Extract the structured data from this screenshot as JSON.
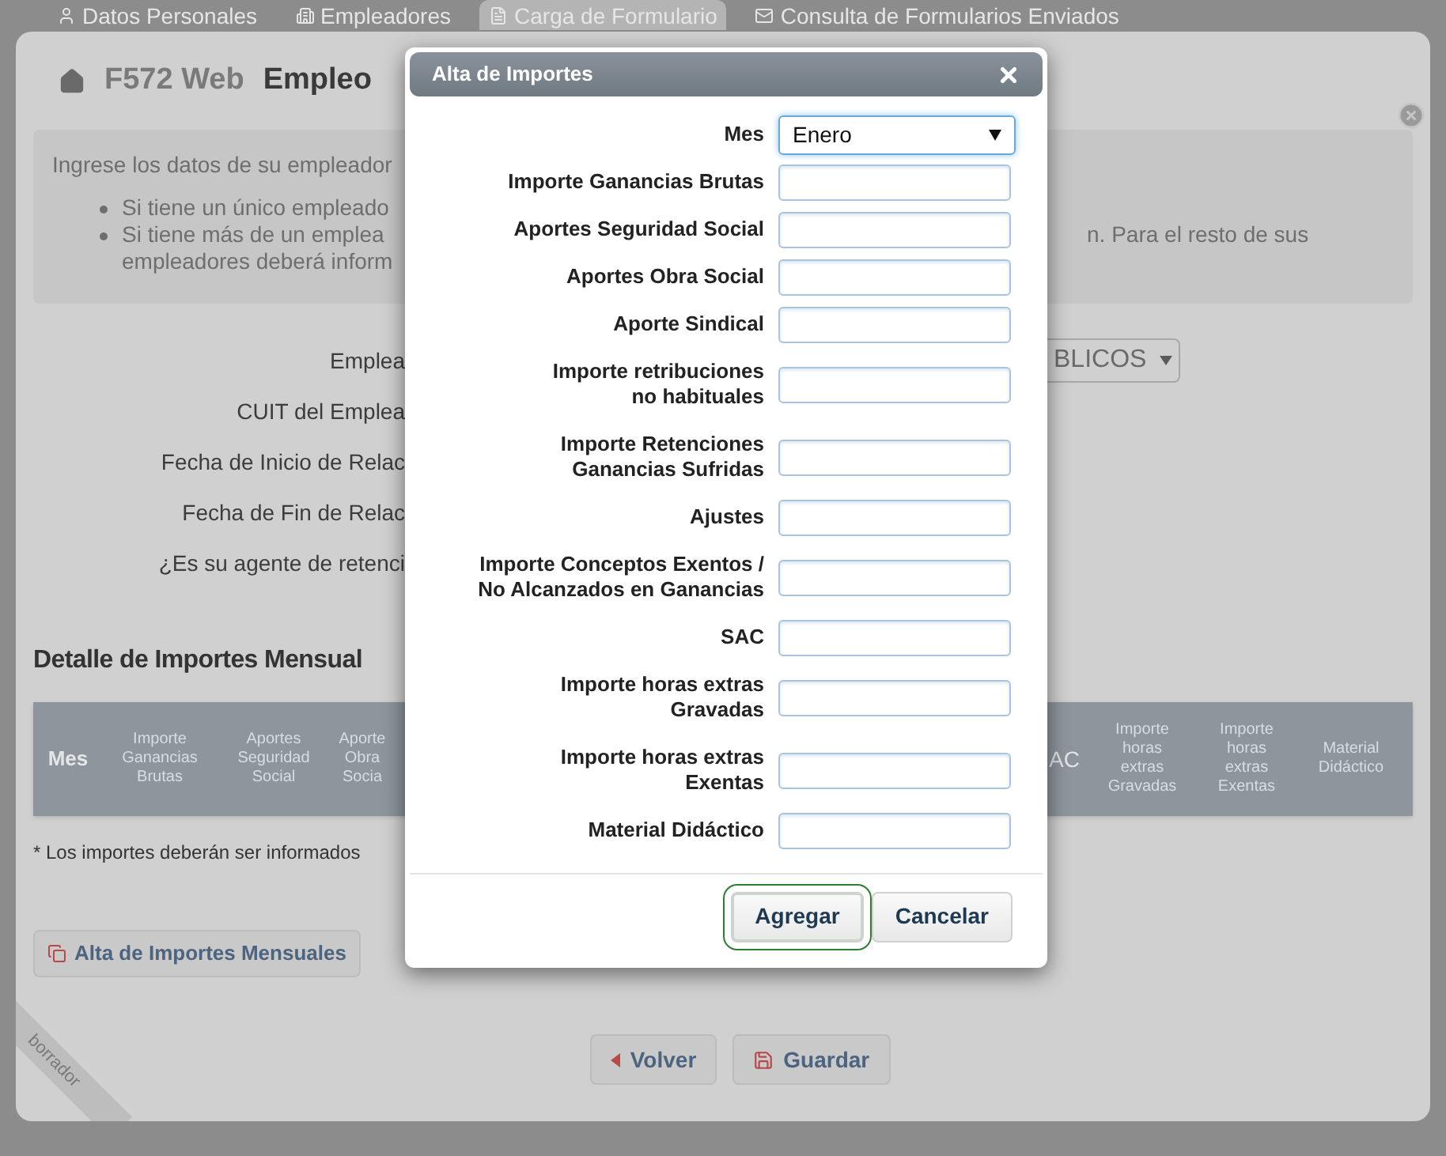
{
  "tabs": [
    {
      "label": "Datos Personales",
      "selected": false
    },
    {
      "label": "Empleadores",
      "selected": false
    },
    {
      "label": "Carga de Formulario",
      "selected": true
    },
    {
      "label": "Consulta de Formularios Enviados",
      "selected": false
    }
  ],
  "breadcrumb": [
    "F572 Web",
    "Empleo"
  ],
  "info": {
    "intro": "Ingrese los datos de su empleador",
    "bullets": [
      {
        "lines": [
          {
            "left": "Si tiene un único empleado"
          }
        ]
      },
      {
        "lines": [
          {
            "left": "Si tiene más de un emplea",
            "right": "n. Para el resto de sus"
          },
          {
            "left": "empleadores deberá inform"
          }
        ]
      }
    ]
  },
  "employer_form": [
    {
      "label": "Emplea",
      "value": "BLICOS"
    },
    {
      "label": "CUIT del Emplea"
    },
    {
      "label": "Fecha de Inicio de Relac"
    },
    {
      "label": "Fecha de Fin de Relac"
    },
    {
      "label": "¿Es su agente de retenci"
    }
  ],
  "detail_title": "Detalle de Importes Mensual",
  "table": {
    "columns_left": [
      "Mes",
      "Importe Ganancias Brutas",
      "Aportes Seguridad Social",
      "Aporte Obra Socia"
    ],
    "columns_right": [
      "AC",
      "Importe horas extras Gravadas",
      "Importe horas extras Exentas",
      "Material Didáctico"
    ]
  },
  "footnote": "* Los importes deberán ser informados",
  "add_button": "Alta de Importes Mensuales",
  "ribbon": "borrador",
  "bottom_buttons": [
    {
      "label": "Volver"
    },
    {
      "label": "Guardar"
    }
  ],
  "dialog": {
    "title": "Alta de Importes",
    "fields": [
      {
        "kind": "select",
        "label": "Mes",
        "value": "Enero"
      },
      {
        "kind": "input",
        "label": "Importe Ganancias Brutas"
      },
      {
        "kind": "input",
        "label": "Aportes Seguridad Social"
      },
      {
        "kind": "input",
        "label": "Aportes Obra Social"
      },
      {
        "kind": "input",
        "label": "Aporte Sindical"
      },
      {
        "kind": "input",
        "label": "Importe retribuciones\nno habituales"
      },
      {
        "kind": "input",
        "label": "Importe Retenciones\nGanancias Sufridas"
      },
      {
        "kind": "input",
        "label": "Ajustes"
      },
      {
        "kind": "input",
        "label": "Importe Conceptos Exentos /\nNo Alcanzados en Ganancias"
      },
      {
        "kind": "input",
        "label": "SAC"
      },
      {
        "kind": "input",
        "label": "Importe horas extras\nGravadas"
      },
      {
        "kind": "input",
        "label": "Importe horas extras\nExentas"
      },
      {
        "kind": "input",
        "label": "Material Didáctico"
      }
    ],
    "buttons": [
      {
        "label": "Agregar",
        "focused": true
      },
      {
        "label": "Cancelar",
        "focused": false
      }
    ]
  }
}
